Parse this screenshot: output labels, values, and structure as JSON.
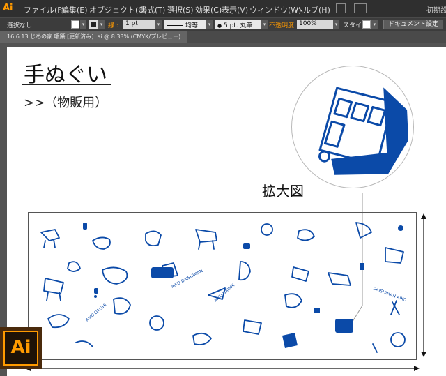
{
  "menubar": {
    "logo": "Ai",
    "items": [
      "ファイル(F)",
      "編集(E)",
      "オブジェクト(O)",
      "書式(T)",
      "選択(S)",
      "効果(C)",
      "表示(V)",
      "ウィンドウ(W)",
      "ヘルプ(H)"
    ],
    "right_label": "初期設定"
  },
  "control": {
    "selection": "選択なし",
    "stroke_label": "線 :",
    "stroke_weight": "1 pt",
    "profile_label": "均等",
    "brush_label": "5 pt. 丸筆",
    "opacity_label": "不透明度 :",
    "opacity_value": "100%",
    "style_label": "スタイル :",
    "doc_settings": "ドキュメント設定"
  },
  "document": {
    "tab": "16.6.13 じめの家 暖簾 [更新済み] .ai @ 8.33% (CMYK/プレビュー)"
  },
  "artboard": {
    "title": "手ぬぐい",
    "subtitle": ">>（物販用）",
    "zoom_label": "拡大図"
  },
  "badge": {
    "label": "Ai"
  },
  "colors": {
    "ink": "#0b4aa8",
    "accent": "#ff9a00"
  }
}
